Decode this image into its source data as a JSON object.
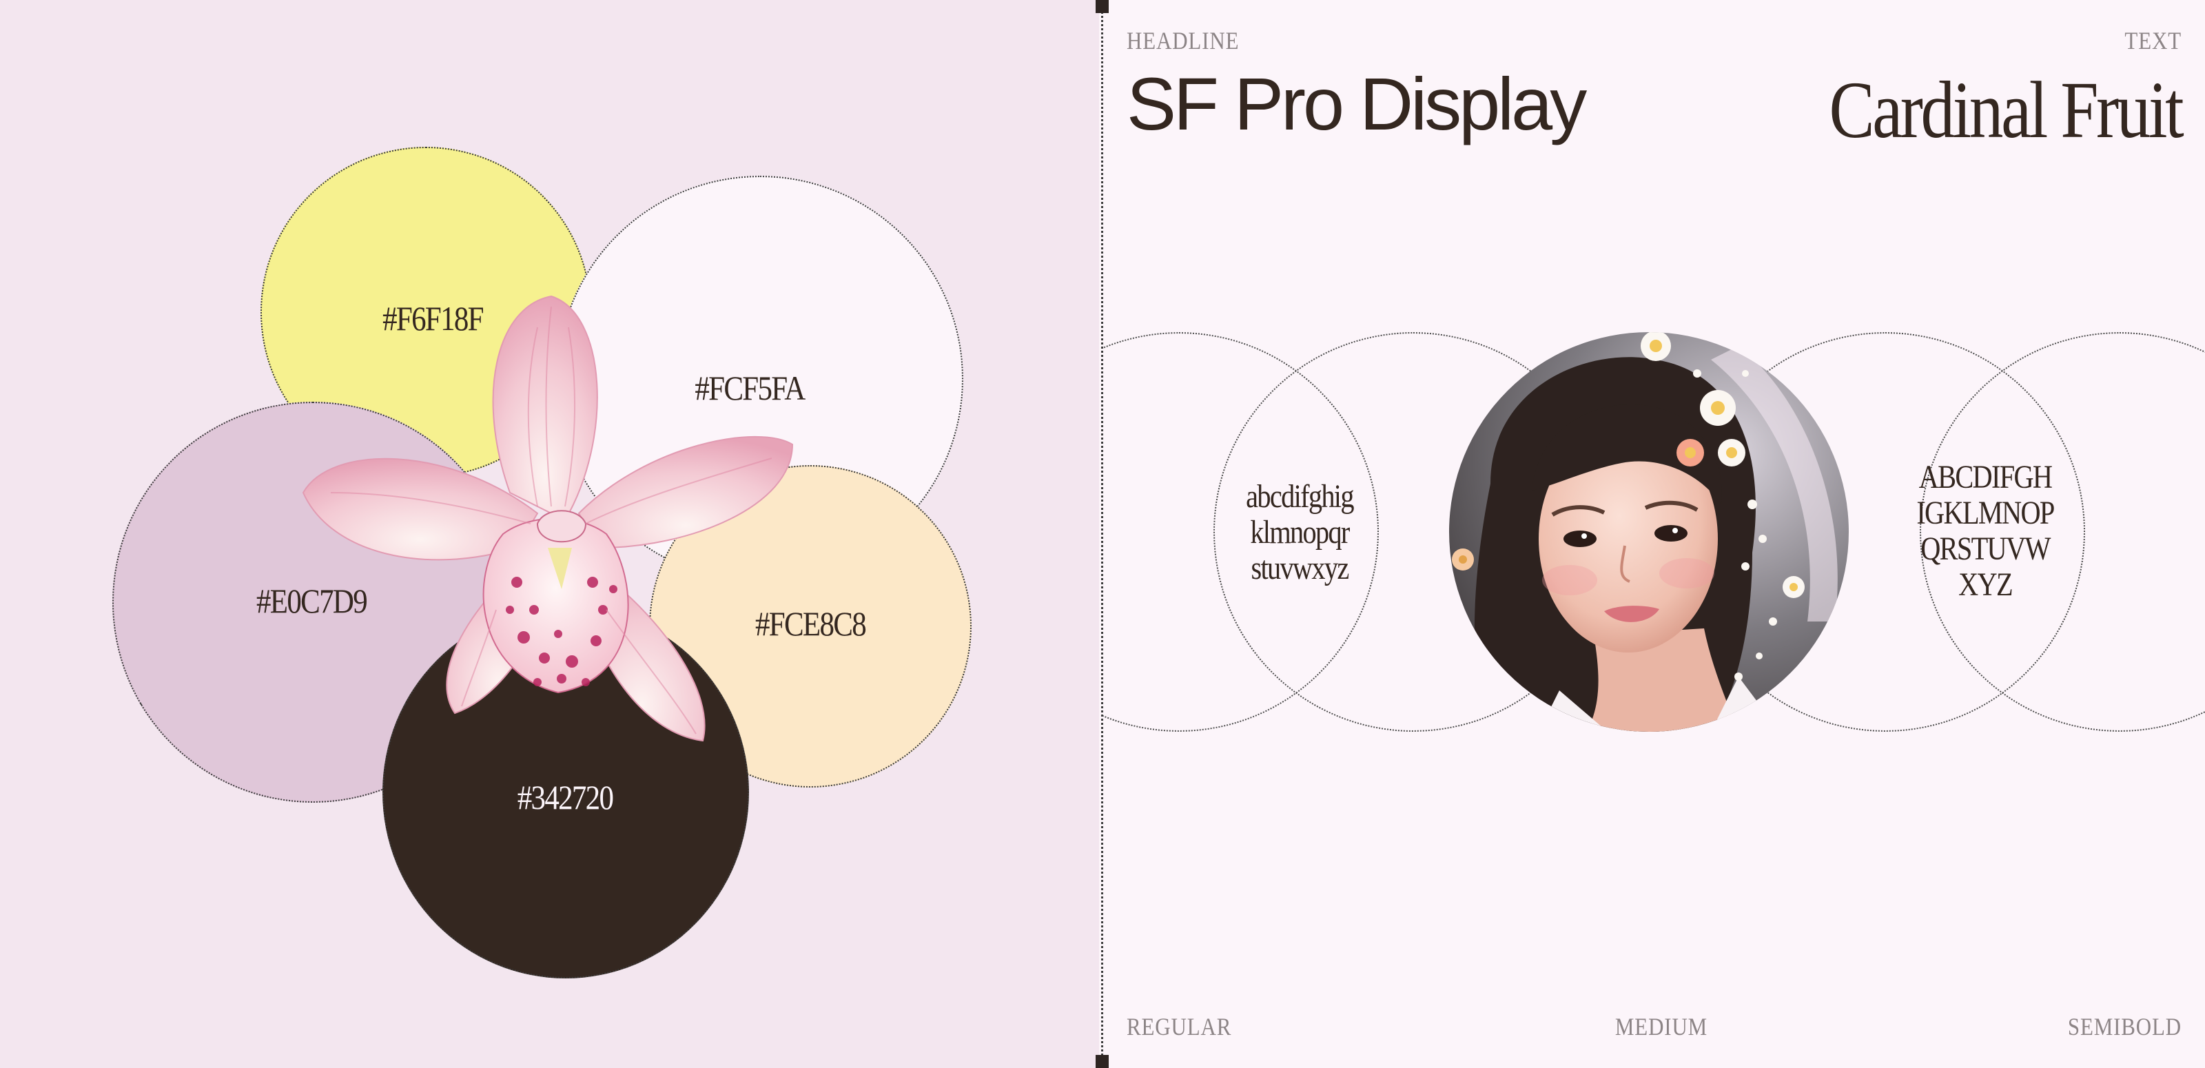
{
  "palette": {
    "swatches": [
      {
        "label": "#F6F18F",
        "color": "#F6F18F"
      },
      {
        "label": "#FCF5FA",
        "color": "#FCF5FA"
      },
      {
        "label": "#E0C7D9",
        "color": "#E0C7D9"
      },
      {
        "label": "#FCE8C8",
        "color": "#FCE8C8"
      },
      {
        "label": "#342720",
        "color": "#342720"
      }
    ],
    "flower_icon": "orchid-image"
  },
  "typography": {
    "headline_caption": "HEADLINE",
    "text_caption": "TEXT",
    "headline_font": "SF Pro Display",
    "text_font": "Cardinal Fruit",
    "lowercase_lines": [
      "abcdifghig",
      "klmnopqr",
      "stuvwxyz"
    ],
    "uppercase_lines": [
      "ABCDIFGH",
      "IGKLMNOP",
      "QRSTUVW",
      "XYZ"
    ],
    "weights": {
      "regular": "REGULAR",
      "medium": "MEDIUM",
      "semibold": "SEMIBOLD"
    },
    "portrait_icon": "portrait-photo"
  }
}
